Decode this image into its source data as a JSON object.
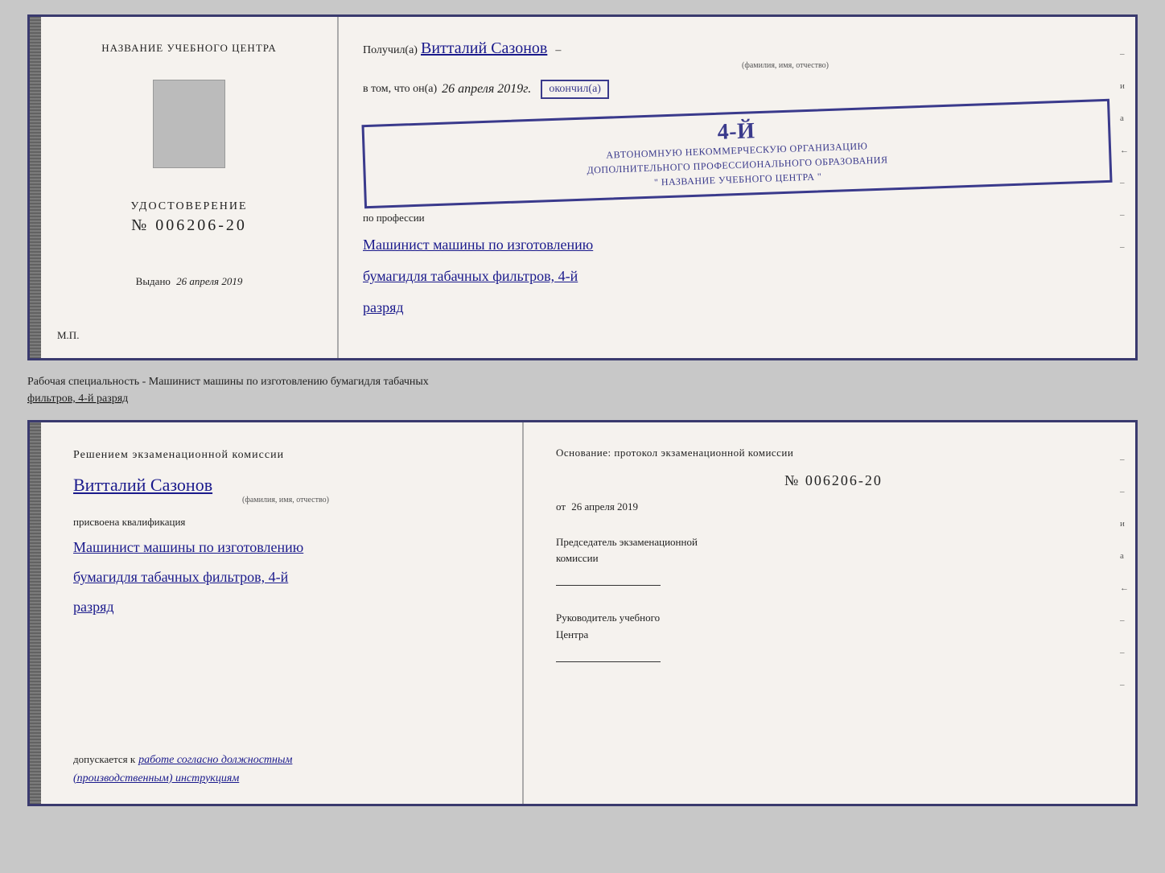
{
  "topCert": {
    "left": {
      "centerLabel": "НАЗВАНИЕ УЧЕБНОГО ЦЕНТРА",
      "udostTitle": "УДОСТОВЕРЕНИЕ",
      "udostNumber": "№ 006206-20",
      "vydanoLabel": "Выдано",
      "vydanoDate": "26 апреля 2019",
      "mpLabel": "М.П."
    },
    "right": {
      "poluchilPrefix": "Получил(а)",
      "recipientName": "Витталий Сазонов",
      "fioLabel": "(фамилия, имя, отчество)",
      "dash": "–",
      "vtomPrefix": "в том, что он(а)",
      "vtomDate": "26 апреля 2019г.",
      "okonchilLabel": "окончил(а)",
      "stampNum": "4-й",
      "stampLine1": "АВТОНОМНУЮ НЕКОММЕРЧЕСКУЮ ОРГАНИЗАЦИЮ",
      "stampLine2": "ДОПОЛНИТЕЛЬНОГО ПРОФЕССИОНАЛЬНОГО ОБРАЗОВАНИЯ",
      "stampLine3": "\" НАЗВАНИЕ УЧЕБНОГО ЦЕНТРА \"",
      "profLabel": "по профессии",
      "profHandwritten1": "Машинист машины по изготовлению",
      "profHandwritten2": "бумагидля табачных фильтров, 4-й",
      "profHandwritten3": "разряд",
      "edgeMarks": [
        "–",
        "и",
        "а",
        "←",
        "–",
        "–",
        "–"
      ]
    }
  },
  "separatorText": {
    "line1": "Рабочая специальность - Машинист машины по изготовлению бумагидля табачных",
    "line2": "фильтров, 4-й разряд"
  },
  "bottomCert": {
    "left": {
      "komissiaTitle": "Решением  экзаменационной  комиссии",
      "recipientName": "Витталий Сазонов",
      "fioLabel": "(фамилия, имя, отчество)",
      "assignLabel": "присвоена квалификация",
      "kvalif1": "Машинист машины по изготовлению",
      "kvalif2": "бумагидля табачных фильтров, 4-й",
      "kvalif3": "разряд",
      "dopuskaetsyaPrefix": "допускается к",
      "dopuskaetsyaHandwritten": "работе согласно должностным\n(производственным) инструкциям"
    },
    "right": {
      "osnovTitle": "Основание:  протокол  экзаменационной  комиссии",
      "protNumber": "№  006206-20",
      "otLabel": "от",
      "otDate": "26 апреля 2019",
      "predsedLabel": "Председатель экзаменационной\nкомиссии",
      "rukovLabel": "Руководитель учебного\nЦентра",
      "edgeMarks": [
        "–",
        "–",
        "и",
        "а",
        "←",
        "–",
        "–",
        "–"
      ]
    }
  }
}
